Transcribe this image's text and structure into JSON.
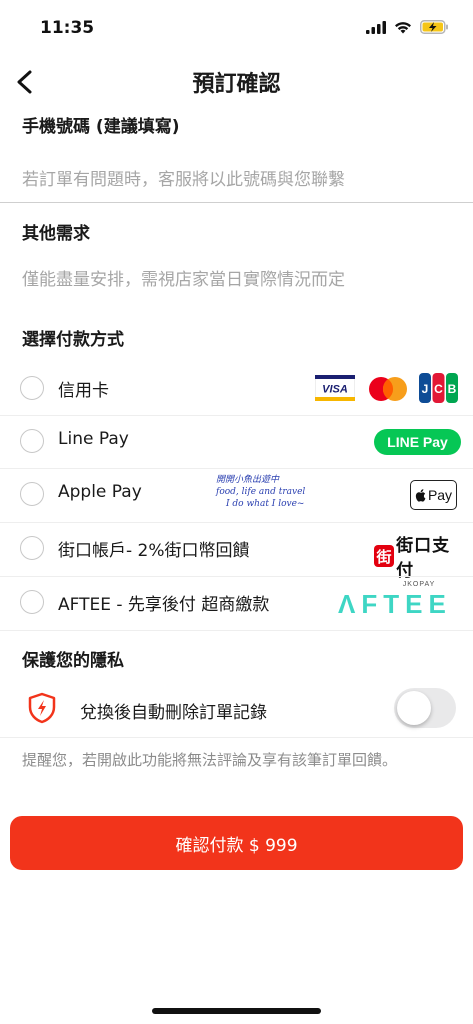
{
  "status_bar": {
    "time": "11:35"
  },
  "nav": {
    "title": "預訂確認"
  },
  "phone_section": {
    "title": "手機號碼 (建議填寫)",
    "placeholder": "若訂單有問題時，客服將以此號碼與您聯繫"
  },
  "requests_section": {
    "title": "其他需求",
    "placeholder": "僅能盡量安排，需視店家當日實際情況而定"
  },
  "payment_section": {
    "title": "選擇付款方式",
    "methods": [
      {
        "label": "信用卡",
        "logos": [
          "VISA",
          "mastercard",
          "JCB"
        ]
      },
      {
        "label": "Line Pay",
        "logo_text": "LINE Pay"
      },
      {
        "label": "Apple Pay",
        "logo_text": "Pay"
      },
      {
        "label": "街口帳戶- 2%街口幣回饋",
        "logo_text_main": "街口支付",
        "logo_text_sub": "JKOPAY"
      },
      {
        "label": "AFTEE - 先享後付 超商繳款",
        "logo_text": "ΛFTEE"
      }
    ],
    "watermark": {
      "line1": "開開小魚出遊中",
      "line2": "food, life and travel",
      "line3": "I do what I love~"
    }
  },
  "privacy_section": {
    "title": "保護您的隱私",
    "toggle_label": "兌換後自動刪除訂單記錄",
    "toggle_on": false,
    "note": "提醒您，若開啟此功能將無法評論及享有該筆訂單回饋。"
  },
  "cta": {
    "label": "確認付款  $ 999"
  },
  "colors": {
    "accent": "#f2341b",
    "line_green": "#06c755",
    "aftee_teal": "#3ed6c4",
    "jko_red": "#e3000f"
  }
}
